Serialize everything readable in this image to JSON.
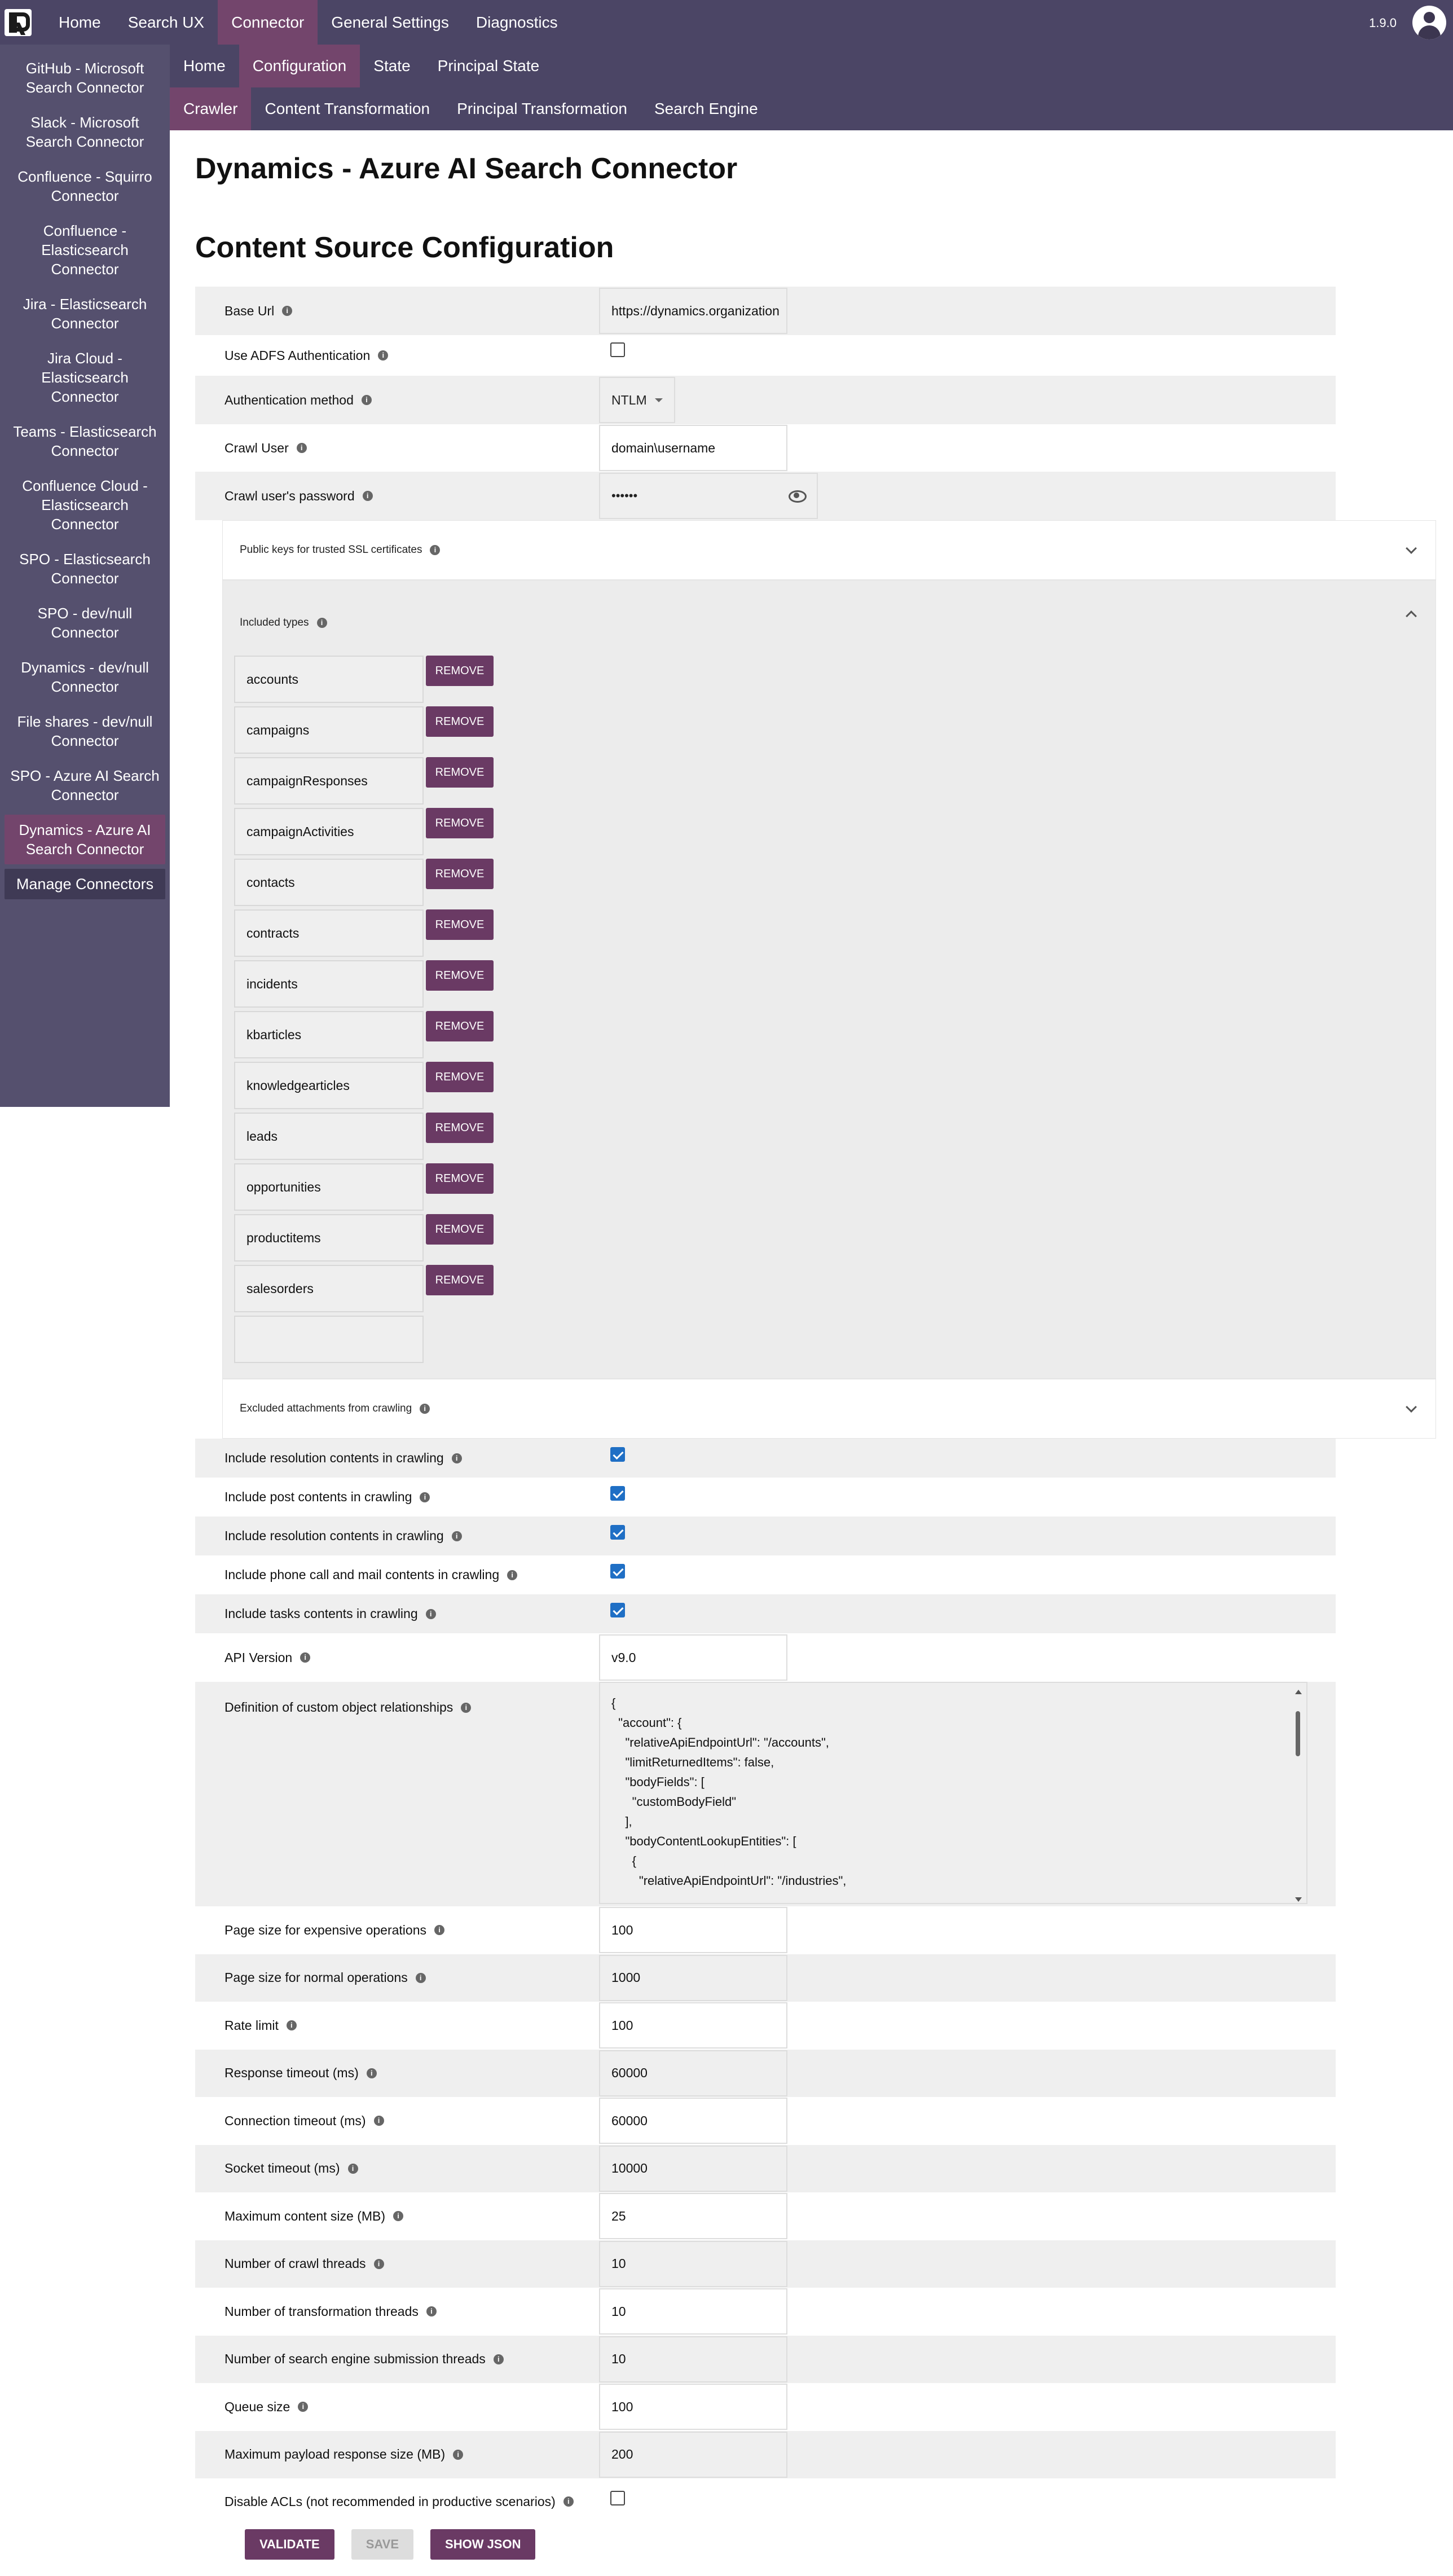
{
  "topnav": {
    "items": [
      "Home",
      "Search UX",
      "Connector",
      "General Settings",
      "Diagnostics"
    ],
    "active": 2,
    "version": "1.9.0"
  },
  "sidebar": {
    "items": [
      "GitHub - Microsoft Search Connector",
      "Slack - Microsoft Search Connector",
      "Confluence - Squirro Connector",
      "Confluence - Elasticsearch Connector",
      "Jira - Elasticsearch Connector",
      "Jira Cloud - Elasticsearch Connector",
      "Teams - Elasticsearch Connector",
      "Confluence Cloud - Elasticsearch Connector",
      "SPO - Elasticsearch Connector",
      "SPO - dev/null Connector",
      "Dynamics - dev/null Connector",
      "File shares - dev/null Connector",
      "SPO - Azure AI Search Connector",
      "Dynamics - Azure AI Search Connector"
    ],
    "active": 13,
    "manage": "Manage Connectors"
  },
  "subnav": {
    "items": [
      "Home",
      "Configuration",
      "State",
      "Principal State"
    ],
    "active": 1
  },
  "subnav2": {
    "items": [
      "Crawler",
      "Content Transformation",
      "Principal Transformation",
      "Search Engine"
    ],
    "active": 0
  },
  "page": {
    "title": "Dynamics - Azure AI Search Connector",
    "section": "Content Source Configuration"
  },
  "form": {
    "base_url": {
      "label": "Base Url",
      "value": "https://dynamics.organization"
    },
    "adfs": {
      "label": "Use ADFS Authentication",
      "checked": false
    },
    "auth_method": {
      "label": "Authentication method",
      "value": "NTLM"
    },
    "crawl_user": {
      "label": "Crawl User",
      "value": "domain\\username"
    },
    "crawl_password": {
      "label": "Crawl user's password",
      "value": "••••••"
    },
    "ssl_keys": {
      "label": "Public keys for trusted SSL certificates"
    },
    "included_types": {
      "label": "Included types",
      "remove_label": "REMOVE",
      "items": [
        "accounts",
        "campaigns",
        "campaignResponses",
        "campaignActivities",
        "contacts",
        "contracts",
        "incidents",
        "kbarticles",
        "knowledgearticles",
        "leads",
        "opportunities",
        "productitems",
        "salesorders"
      ]
    },
    "excluded_attachments": {
      "label": "Excluded attachments from crawling"
    },
    "checks": [
      {
        "label": "Include resolution contents in crawling",
        "checked": true
      },
      {
        "label": "Include post contents in crawling",
        "checked": true
      },
      {
        "label": "Include resolution contents in crawling",
        "checked": true
      },
      {
        "label": "Include phone call and mail contents in crawling",
        "checked": true
      },
      {
        "label": "Include tasks contents in crawling",
        "checked": true
      }
    ],
    "api_version": {
      "label": "API Version",
      "value": "v9.0"
    },
    "custom_relationships": {
      "label": "Definition of custom object relationships",
      "value": "{\n  \"account\": {\n    \"relativeApiEndpointUrl\": \"/accounts\",\n    \"limitReturnedItems\": false,\n    \"bodyFields\": [\n      \"customBodyField\"\n    ],\n    \"bodyContentLookupEntities\": [\n      {\n        \"relativeApiEndpointUrl\": \"/industries\","
    },
    "numeric": [
      {
        "label": "Page size for expensive operations",
        "value": "100"
      },
      {
        "label": "Page size for normal operations",
        "value": "1000"
      },
      {
        "label": "Rate limit",
        "value": "100"
      },
      {
        "label": "Response timeout (ms)",
        "value": "60000"
      },
      {
        "label": "Connection timeout (ms)",
        "value": "60000"
      },
      {
        "label": "Socket timeout (ms)",
        "value": "10000"
      },
      {
        "label": "Maximum content size (MB)",
        "value": "25"
      },
      {
        "label": "Number of crawl threads",
        "value": "10"
      },
      {
        "label": "Number of transformation threads",
        "value": "10"
      },
      {
        "label": "Number of search engine submission threads",
        "value": "10"
      },
      {
        "label": "Queue size",
        "value": "100"
      },
      {
        "label": "Maximum payload response size (MB)",
        "value": "200"
      }
    ],
    "disable_acls": {
      "label": "Disable ACLs (not recommended in productive scenarios)",
      "checked": false
    }
  },
  "buttons": {
    "validate": "VALIDATE",
    "save": "SAVE",
    "show_json": "SHOW JSON"
  }
}
